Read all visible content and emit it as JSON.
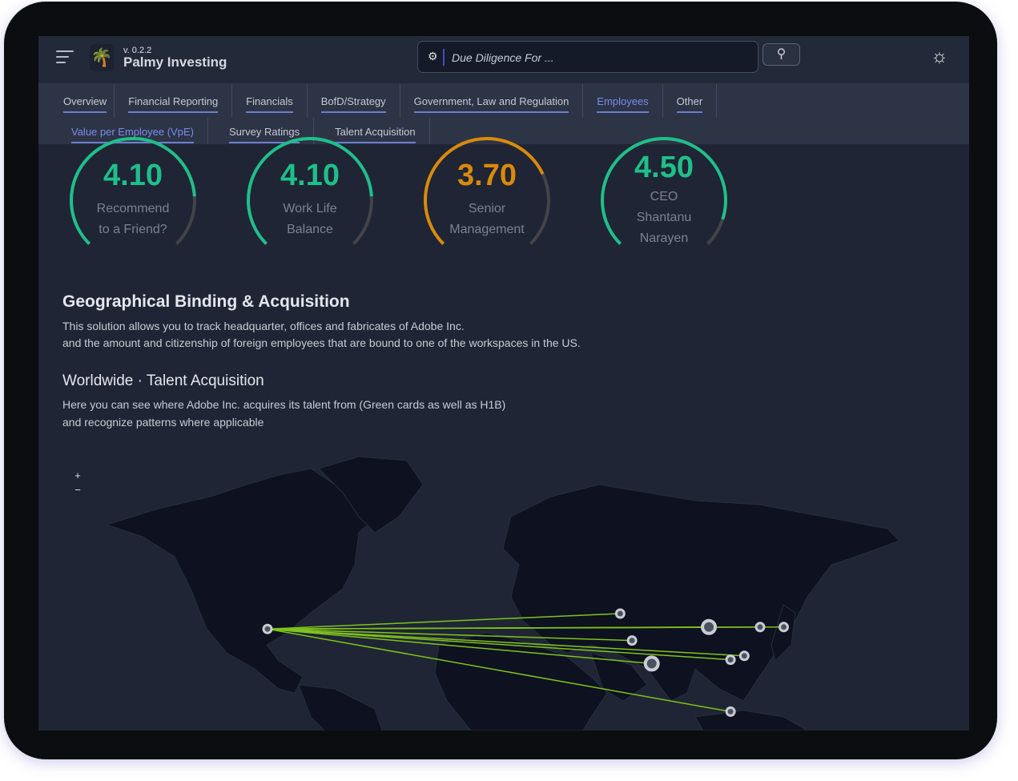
{
  "header": {
    "version": "v. 0.2.2",
    "brand": "Palmy Investing",
    "search_placeholder": "Due Diligence For ...",
    "icons": {
      "menu": "hamburger-icon",
      "logo": "palm-tree-icon",
      "search_settings": "gear-icon",
      "search": "magnifier-icon",
      "theme": "sun-icon"
    }
  },
  "nav": {
    "tabs": [
      {
        "label": "Overview"
      },
      {
        "label": "Financial Reporting"
      },
      {
        "label": "Financials"
      },
      {
        "label": "BofD/Strategy"
      },
      {
        "label": "Government, Law and Regulation"
      },
      {
        "label": "Employees",
        "active": true
      },
      {
        "label": "Other"
      }
    ],
    "subtabs": [
      {
        "label": "Value per Employee (VpE)",
        "active": true
      },
      {
        "label": "Survey Ratings"
      },
      {
        "label": "Talent Acquisition"
      }
    ]
  },
  "gauges": [
    {
      "value": "4.10",
      "score": 4.1,
      "max": 5,
      "line1": "Recommend",
      "line2": "to a Friend?",
      "color": "#1fbf8a"
    },
    {
      "value": "4.10",
      "score": 4.1,
      "max": 5,
      "line1": "Work Life",
      "line2": "Balance",
      "color": "#1fbf8a"
    },
    {
      "value": "3.70",
      "score": 3.7,
      "max": 5,
      "line1": "Senior",
      "line2": "Management",
      "color": "#d98a0b"
    },
    {
      "value": "4.50",
      "score": 4.5,
      "max": 5,
      "line1": "CEO",
      "line2": "Shantanu",
      "line3": "Narayen",
      "color": "#1fbf8a"
    }
  ],
  "geo": {
    "title": "Geographical Binding & Acquisition",
    "desc1": "This solution allows you to track headquarter, offices and fabricates of Adobe Inc.",
    "desc2": "and the amount and citizenship of foreign employees that are bound to one of the workspaces in the US."
  },
  "talent": {
    "title": "Worldwide · Talent Acquisition",
    "desc1": "Here you can see where Adobe Inc. acquires its talent from (Green cards as well as H1B)",
    "desc2": "and recognize patterns where applicable"
  },
  "map": {
    "zoom_in": "+",
    "zoom_out": "−",
    "line_color": "#7fc31c",
    "origin": {
      "lon": -122,
      "lat": 37
    },
    "destinations": [
      {
        "lon": 57,
        "lat": 45,
        "major": false
      },
      {
        "lon": 102,
        "lat": 38,
        "major": true
      },
      {
        "lon": 128,
        "lat": 38,
        "major": false
      },
      {
        "lon": 140,
        "lat": 38,
        "major": false
      },
      {
        "lon": 63,
        "lat": 31,
        "major": false
      },
      {
        "lon": 120,
        "lat": 23,
        "major": false
      },
      {
        "lon": 113,
        "lat": 21,
        "major": false
      },
      {
        "lon": 73,
        "lat": 19,
        "major": true
      },
      {
        "lon": 113,
        "lat": -6,
        "major": false
      }
    ]
  }
}
